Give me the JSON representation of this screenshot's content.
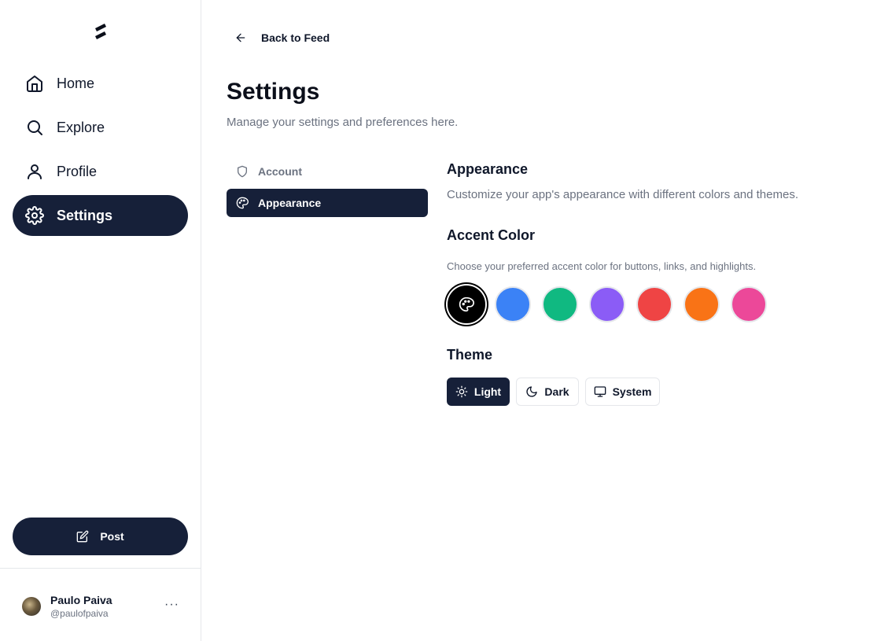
{
  "sidebar": {
    "nav": [
      {
        "label": "Home",
        "icon": "home-icon"
      },
      {
        "label": "Explore",
        "icon": "search-icon"
      },
      {
        "label": "Profile",
        "icon": "user-icon"
      },
      {
        "label": "Settings",
        "icon": "gear-icon",
        "active": true
      }
    ],
    "post_label": "Post",
    "user": {
      "name": "Paulo Paiva",
      "handle": "@paulofpaiva",
      "more": "···"
    }
  },
  "main": {
    "back_label": "Back to Feed",
    "title": "Settings",
    "subtitle": "Manage your settings and preferences here.",
    "tabs": [
      {
        "label": "Account",
        "icon": "shield-icon"
      },
      {
        "label": "Appearance",
        "icon": "palette-icon",
        "active": true
      }
    ],
    "appearance": {
      "title": "Appearance",
      "description": "Customize your app's appearance with different colors and themes.",
      "accent_title": "Accent Color",
      "accent_description": "Choose your preferred accent color for buttons, links, and highlights.",
      "accent_colors": [
        "#000000",
        "#3b82f6",
        "#10b981",
        "#8b5cf6",
        "#ef4444",
        "#f97316",
        "#ec4899"
      ],
      "selected_accent": "#000000",
      "theme_title": "Theme",
      "themes": [
        {
          "label": "Light",
          "icon": "sun-icon",
          "active": true
        },
        {
          "label": "Dark",
          "icon": "moon-icon"
        },
        {
          "label": "System",
          "icon": "monitor-icon"
        }
      ]
    }
  }
}
